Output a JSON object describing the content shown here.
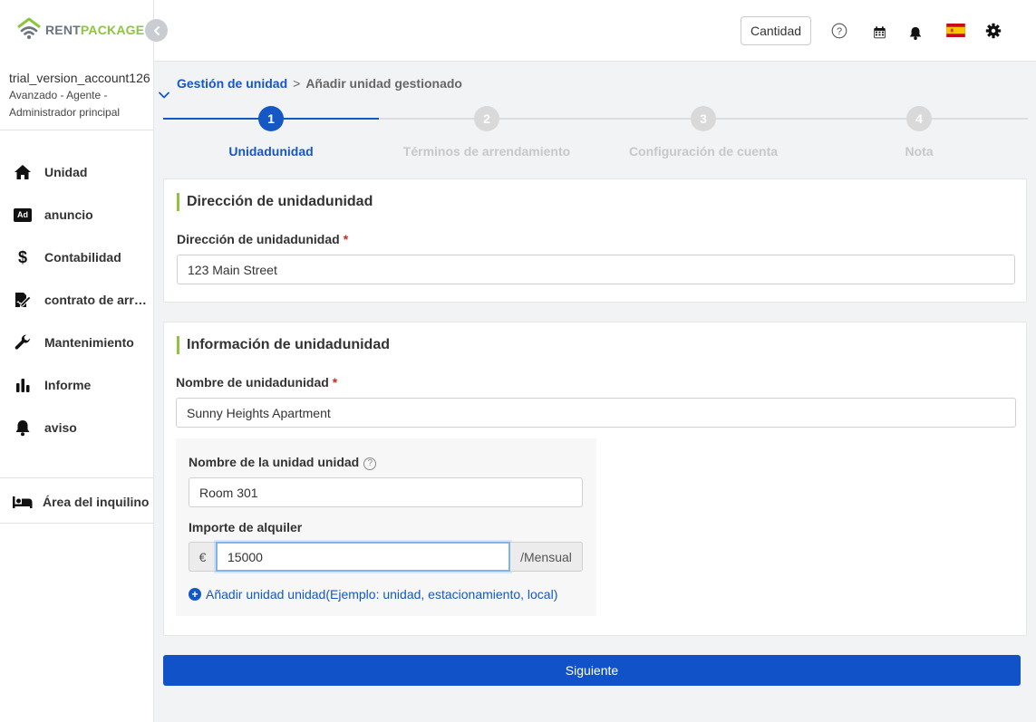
{
  "brand": {
    "part1": "RENT",
    "part2": "PACKAGE",
    "accent": "#8cc63f",
    "primary": "#1557c4"
  },
  "account": {
    "name": "trial_version_account126",
    "role_line1": "Avanzado - Agente -",
    "role_line2": "Administrador principal"
  },
  "sidebar": {
    "items": [
      {
        "label": "Unidad",
        "icon": "home-icon"
      },
      {
        "label": "anuncio",
        "icon": "ad-icon",
        "badge": "Ad"
      },
      {
        "label": "Contabilidad",
        "icon": "dollar-icon"
      },
      {
        "label": "contrato de arrendamiento",
        "icon": "contract-icon"
      },
      {
        "label": "Mantenimiento",
        "icon": "wrench-icon"
      },
      {
        "label": "Informe",
        "icon": "bar-chart-icon"
      },
      {
        "label": "aviso",
        "icon": "bell-icon"
      }
    ],
    "tenant_area": {
      "label": "Área del inquilino",
      "icon": "bed-icon"
    }
  },
  "topbar": {
    "quantity_label": "Cantidad",
    "icons": [
      "help-icon",
      "calendar-icon",
      "bell-icon",
      "spain-flag-icon",
      "gear-icon"
    ]
  },
  "breadcrumb": {
    "parent": "Gestión de unidad",
    "separator": ">",
    "current": "Añadir unidad gestionado"
  },
  "stepper": {
    "steps": [
      {
        "number": "1",
        "label": "Unidadunidad",
        "active": true
      },
      {
        "number": "2",
        "label": "Términos de arrendamiento",
        "active": false
      },
      {
        "number": "3",
        "label": "Configuración de cuenta",
        "active": false
      },
      {
        "number": "4",
        "label": "Nota",
        "active": false
      }
    ]
  },
  "address_card": {
    "title": "Dirección de unidadunidad",
    "field_label": "Dirección de unidadunidad",
    "required_mark": "*",
    "value": "123 Main Street"
  },
  "info_card": {
    "title": "Información de unidadunidad",
    "name_label": "Nombre de unidadunidad",
    "required_mark": "*",
    "name_value": "Sunny Heights Apartment",
    "sub_name_label": "Nombre de la unidad unidad",
    "sub_name_help": "?",
    "sub_name_value": "Room 301",
    "rent_label": "Importe de alquiler",
    "currency": "€",
    "rent_value": "15000",
    "period": "/Mensual",
    "add_link": "Añadir unidad unidad(Ejemplo: unidad, estacionamiento, local)"
  },
  "next_button": "Siguiente"
}
